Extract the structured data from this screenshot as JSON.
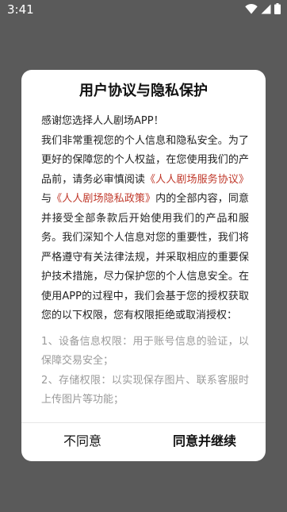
{
  "status_bar": {
    "time": "3:41",
    "icons": [
      "wifi-icon",
      "signal-icon",
      "battery-icon"
    ],
    "icon_color": "#ffffff"
  },
  "dialog": {
    "title": "用户协议与隐私保护",
    "greeting": "感谢您选择人人剧场APP！",
    "para_part1": "我们非常重视您的个人信息和隐私安全。为了更好的保障您的个人权益，在您使用我们的产品前，请务必审慎阅读",
    "link_service": "《人人剧场服务协议》",
    "conjunction": "与",
    "link_privacy": "《人人剧场隐私政策》",
    "para_part2": "内的全部内容，同意并接受全部条款后开始使用我们的产品和服务。我们深知个人信息对您的重要性，我们将严格遵守有关法律法规，并采取相应的重要保护技术措施，尽力保护您的个人信息安全。在使用APP的过程中，我们会基于您的授权获取您的以下权限，您有权限拒绝或取消授权：",
    "permissions": [
      "1、设备信息权限：用于账号信息的验证，以保障交易安全；",
      "2、存储权限：以实现保存图片、联系客服时上传图片等功能；"
    ],
    "disagree_label": "不同意",
    "agree_label": "同意并继续",
    "link_color": "#c0392b",
    "overlay_color": "#5a5a5a"
  }
}
